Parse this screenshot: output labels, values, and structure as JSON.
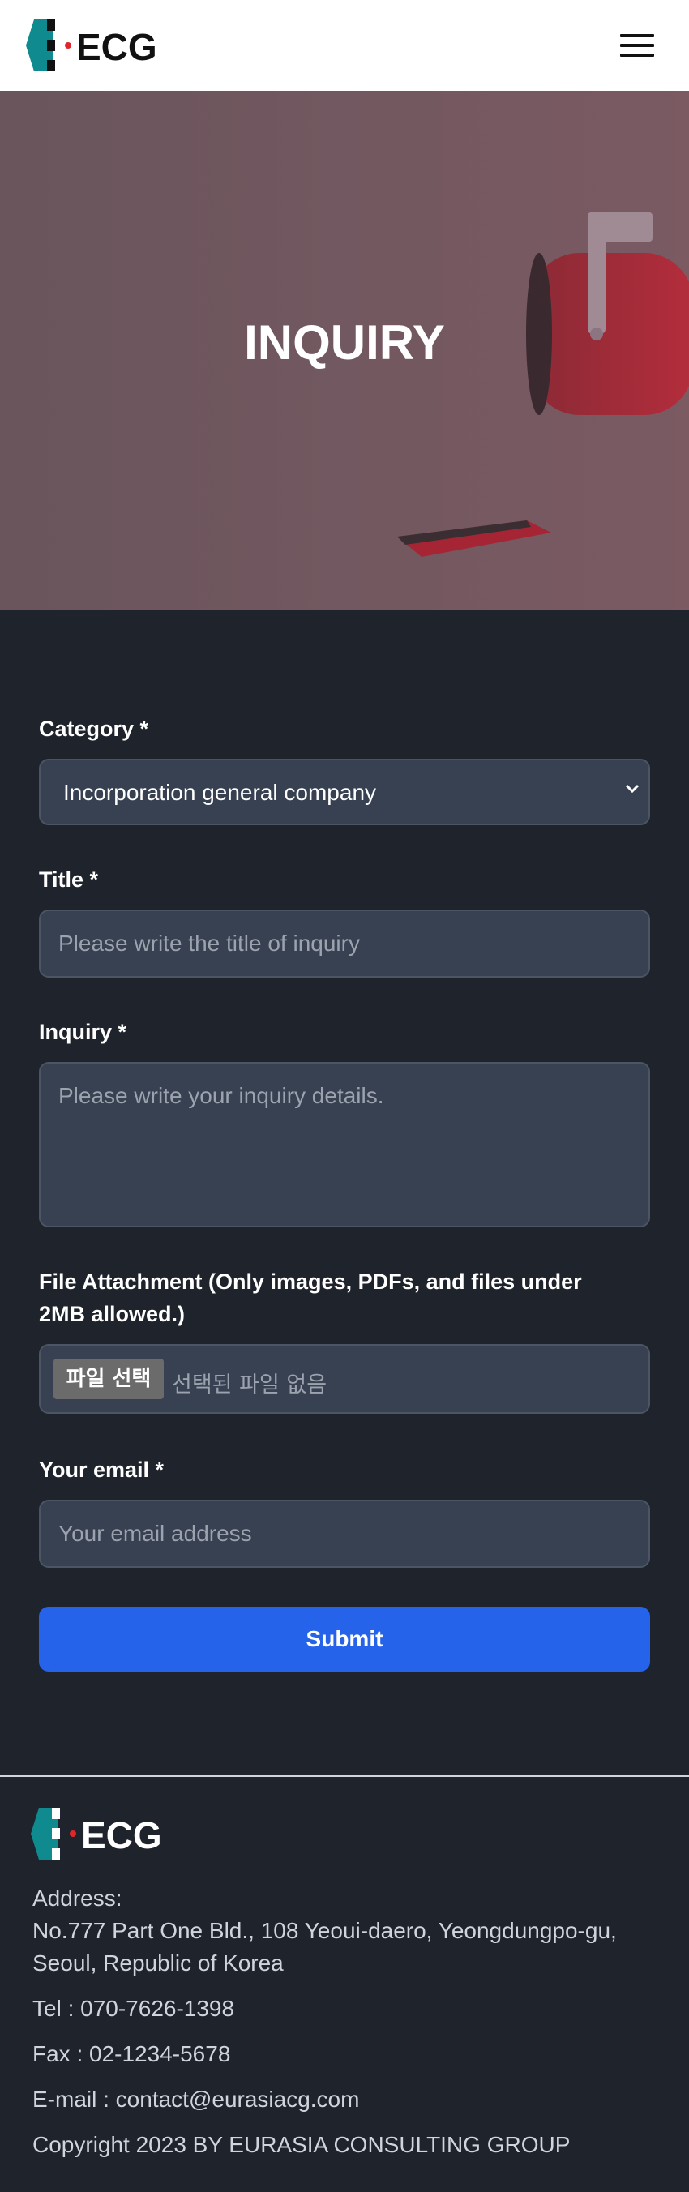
{
  "header": {
    "logo_text": "ECG",
    "menu_icon": "hamburger-icon"
  },
  "hero": {
    "title": "INQUIRY"
  },
  "form": {
    "category": {
      "label": "Category *",
      "value": "Incorporation general company"
    },
    "title": {
      "label": "Title *",
      "placeholder": "Please write the title of inquiry"
    },
    "inquiry": {
      "label": "Inquiry *",
      "placeholder": "Please write your inquiry details."
    },
    "file": {
      "label_line1": "File Attachment (Only images, PDFs, and files under",
      "label_line2": "2MB allowed.)",
      "button": "파일 선택",
      "status": "선택된 파일 없음"
    },
    "email": {
      "label": "Your email *",
      "placeholder": "Your email address"
    },
    "submit": "Submit"
  },
  "footer": {
    "logo_text": "ECG",
    "address_label": "Address:",
    "address_line1": "No.777 Part One Bld., 108 Yeoui-daero, Yeongdungpo-gu,",
    "address_line2": "Seoul, Republic of Korea",
    "tel": "Tel : 070-7626-1398",
    "fax": "Fax : 02-1234-5678",
    "email": "E-mail : contact@eurasiacg.com",
    "copyright": "Copyright 2023 BY EURASIA CONSULTING GROUP"
  },
  "colors": {
    "accent": "#2563eb",
    "field_bg": "#374151",
    "page_bg": "#1f232c",
    "logo_teal": "#0f8a8f",
    "logo_red": "#e0262a"
  }
}
